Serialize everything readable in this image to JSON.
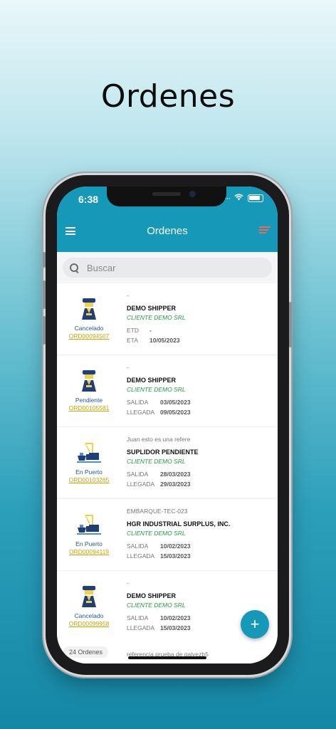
{
  "headline": "Ordenes",
  "status_bar": {
    "time": "6:38"
  },
  "appbar": {
    "title": "Ordenes"
  },
  "search": {
    "placeholder": "Buscar"
  },
  "orders": [
    {
      "icon": "officer-icon",
      "status": "Cancelado",
      "order_id": "ORD00094507",
      "reference": "-",
      "shipper": "DEMO SHIPPER",
      "client": "CLIENTE DEMO SRL",
      "label1": "ETD",
      "value1": "-",
      "label2": "ETA",
      "value2": "10/05/2023"
    },
    {
      "icon": "officer-icon",
      "status": "Pendiente",
      "order_id": "ORD00105581",
      "reference": "-",
      "shipper": "DEMO SHIPPER",
      "client": "CLIENTE DEMO SRL",
      "label1": "SALIDA",
      "value1": "03/05/2023",
      "label2": "LLEGADA",
      "value2": "09/05/2023"
    },
    {
      "icon": "port-crane-icon",
      "status": "En Puerto",
      "order_id": "ORD00103265",
      "reference": "Juan esto es una refere",
      "shipper": "SUPLIDOR PENDIENTE",
      "client": "CLIENTE DEMO SRL",
      "label1": "SALIDA",
      "value1": "28/03/2023",
      "label2": "LLEGADA",
      "value2": "29/03/2023"
    },
    {
      "icon": "port-crane-icon",
      "status": "En Puerto",
      "order_id": "ORD00094119",
      "reference": "EMBARQUE-TEC-023",
      "shipper": "HGR INDUSTRIAL SURPLUS, INC.",
      "client": "CLIENTE DEMO SRL",
      "label1": "SALIDA",
      "value1": "10/02/2023",
      "label2": "LLEGADA",
      "value2": "15/03/2023"
    },
    {
      "icon": "officer-icon",
      "status": "Cancelado",
      "order_id": "ORD00099958",
      "reference": "-",
      "shipper": "DEMO SHIPPER",
      "client": "CLIENTE DEMO SRL",
      "label1": "SALIDA",
      "value1": "10/02/2023",
      "label2": "LLEGADA",
      "value2": "15/03/2023"
    }
  ],
  "partial_row": {
    "reference": "referencia prueba de galvezb5"
  },
  "order_count": "24 Ordenes",
  "fab": {
    "label": "+"
  },
  "colors": {
    "primary": "#1699b9",
    "status_text": "#1e5b9c",
    "order_link": "#c9a300",
    "client": "#22a040"
  }
}
